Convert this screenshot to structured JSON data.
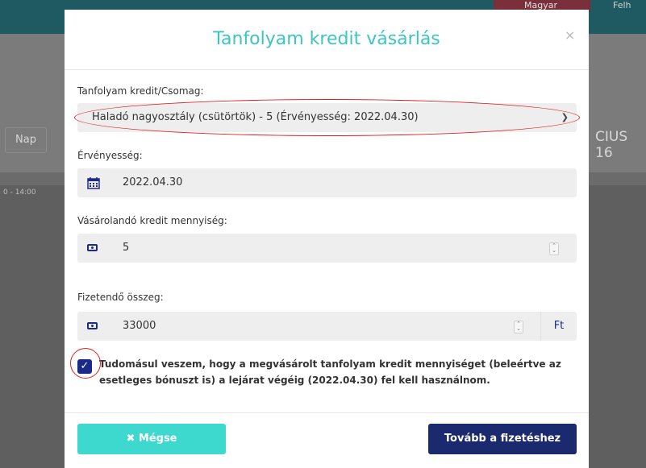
{
  "background": {
    "lang_label": "Magyar",
    "user_label": "Felh",
    "nap_button": "Nap",
    "date_fragment": "CIUS 16",
    "time_fragment": "0 - 14:00"
  },
  "modal": {
    "title": "Tanfolyam kredit vásárlás",
    "close_symbol": "×",
    "package": {
      "label": "Tanfolyam kredit/Csomag:",
      "selected": "Haladó nagyosztály (csütörtök) - 5 (Érvényesség: 2022.04.30)"
    },
    "validity": {
      "label": "Érvényesség:",
      "value": "2022.04.30",
      "icon": "calendar-icon"
    },
    "quantity": {
      "label": "Vásárolandó kredit mennyiség:",
      "value": "5",
      "icon": "money-icon"
    },
    "amount": {
      "label": "Fizetendő összeg:",
      "value": "33000",
      "unit": "Ft",
      "icon": "money-icon"
    },
    "consent": {
      "checked": true,
      "text": "Tudomásul veszem, hogy a megvásárolt tanfolyam kredit mennyiséget (beleértve az esetleges bónuszt is) a lejárat végéig (2022.04.30) fel kell használnom."
    },
    "buttons": {
      "cancel": "✖ Mégse",
      "next": "Tovább a fizetéshez"
    }
  },
  "colors": {
    "accent_title": "#3dc4c4",
    "primary": "#1b2a6e",
    "cancel": "#3dd9cf",
    "annotation": "#e02020"
  }
}
